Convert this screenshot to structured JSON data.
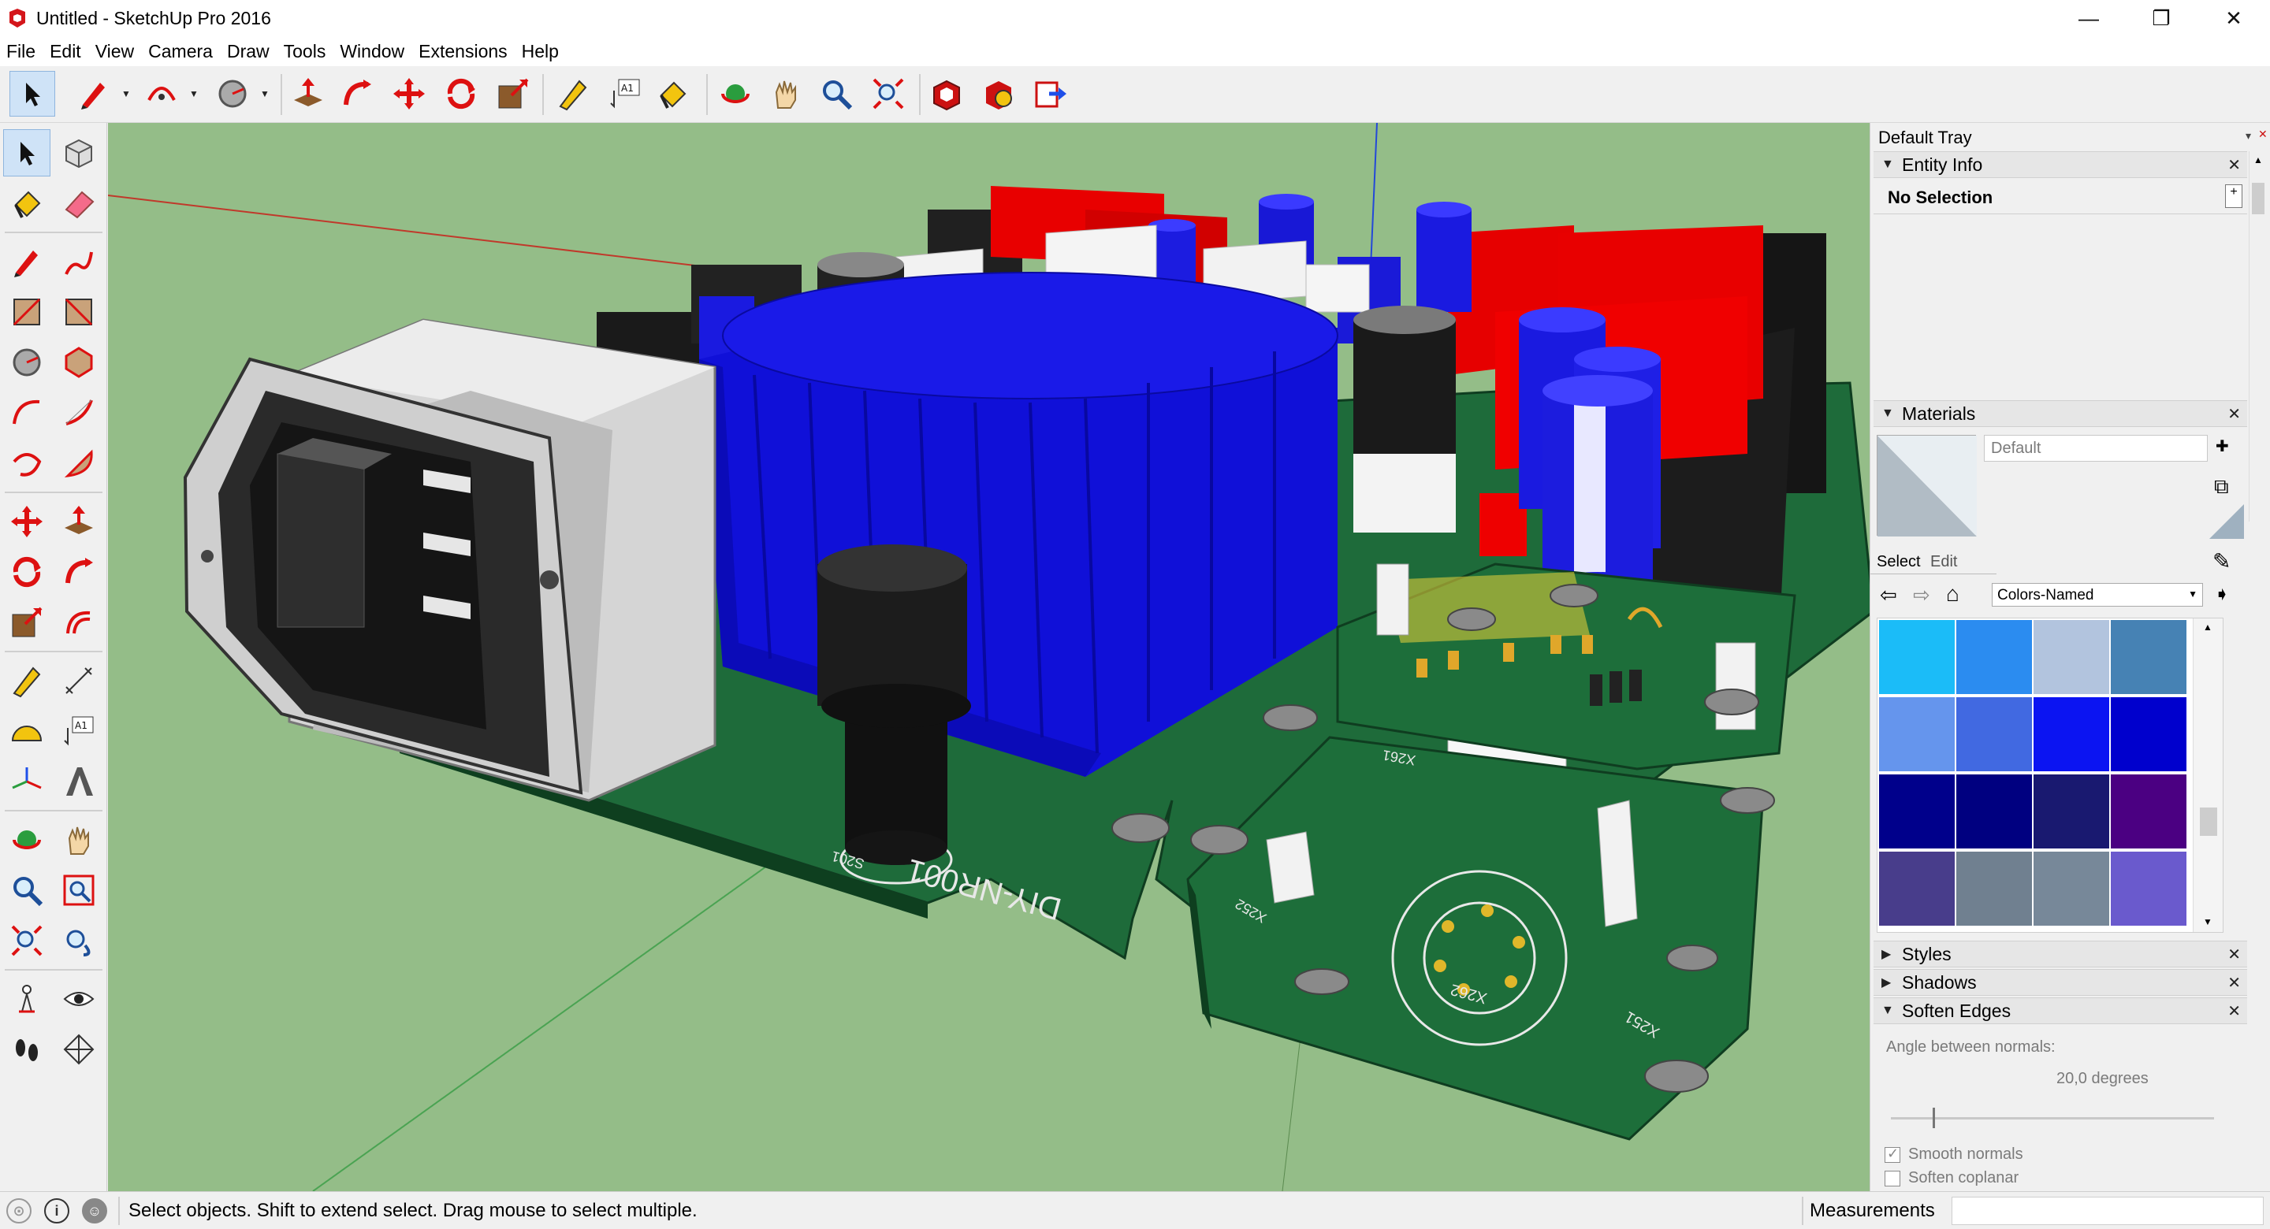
{
  "window": {
    "title": "Untitled - SketchUp Pro 2016",
    "minimize_glyph": "—",
    "restore_glyph": "❐",
    "close_glyph": "✕"
  },
  "menu": [
    "File",
    "Edit",
    "View",
    "Camera",
    "Draw",
    "Tools",
    "Window",
    "Extensions",
    "Help"
  ],
  "toolbar_icons": [
    "select-icon",
    "pencil-line-icon",
    "arc-icon",
    "circle-shape-icon",
    "push-pull-icon",
    "follow-me-icon",
    "move-icon",
    "rotate-icon",
    "scale-icon",
    "tape-measure-icon",
    "text-label-icon",
    "paint-bucket-icon",
    "orbit-icon",
    "pan-icon",
    "zoom-icon",
    "zoom-extents-icon",
    "warehouse-icon",
    "extension-warehouse-icon",
    "send-to-layout-icon"
  ],
  "text_tool_label": "A1",
  "tray": {
    "title": "Default Tray",
    "entity_info": {
      "title": "Entity Info",
      "selection": "No Selection"
    },
    "materials": {
      "title": "Materials",
      "name_value": "Default",
      "tabs": [
        "Select",
        "Edit"
      ],
      "library": "Colors-Named",
      "swatches": [
        "#1bbcf8",
        "#2b8cf0",
        "#b2c4de",
        "#4682b4",
        "#6595ed",
        "#4169e1",
        "#0b14f2",
        "#0000cd",
        "#00008b",
        "#000080",
        "#191970",
        "#4b0082",
        "#483d8b",
        "#708090",
        "#778899",
        "#6a5acd"
      ]
    },
    "styles_title": "Styles",
    "shadows_title": "Shadows",
    "soften_edges": {
      "title": "Soften Edges",
      "angle_label": "Angle between normals:",
      "angle_value": "20,0  degrees",
      "slider_fraction": 0.13,
      "smooth_normals_label": "Smooth normals",
      "smooth_normals_checked": true,
      "soften_coplanar_label": "Soften coplanar",
      "soften_coplanar_checked": false
    }
  },
  "status": {
    "text": "Select objects. Shift to extend select. Drag mouse to select multiple.",
    "measurements_label": "Measurements"
  },
  "model_labels": {
    "board_label": "DIY-NR001",
    "s201": "S201",
    "x252": "X252",
    "x262": "X262",
    "x251": "X251",
    "x261": "X261"
  },
  "colors": {
    "ground": "#94bd88",
    "pcb": "#1e6b3a",
    "heatsink_blue": "#1a1adb",
    "cap_red": "#e80000",
    "accent_select": "#cfe3f7"
  }
}
